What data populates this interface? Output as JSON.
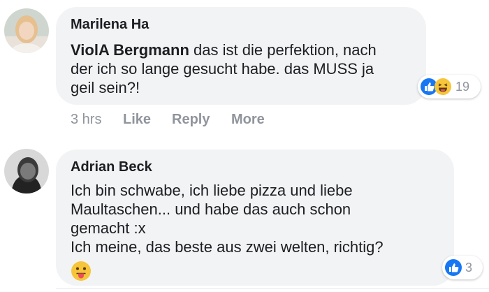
{
  "comments": [
    {
      "author": "Marilena Ha",
      "mention": "ViolA Bergmann",
      "lines": [
        "das ist die perfektion, nach",
        "der ich so lange gesucht habe. das MUSS ja",
        "geil sein?!"
      ],
      "reaction_count": "19",
      "reactions": [
        "like-icon",
        "haha-icon"
      ],
      "timestamp": "3 hrs",
      "actions": [
        "Like",
        "Reply",
        "More"
      ]
    },
    {
      "author": "Adrian Beck",
      "lines": [
        "Ich bin schwabe, ich liebe pizza und liebe",
        "Maultaschen... und habe das auch schon",
        "gemacht :x",
        "Ich meine, das beste aus zwei welten, richtig?"
      ],
      "emoji": "tongue-out-emoji",
      "reaction_count": "3",
      "reactions": [
        "like-icon"
      ]
    }
  ],
  "colors": {
    "bubble": "#f2f3f5",
    "text": "#1c1e21",
    "meta": "#90949c",
    "like_blue": "#1877f2",
    "haha_yellow": "#f7c53b"
  }
}
